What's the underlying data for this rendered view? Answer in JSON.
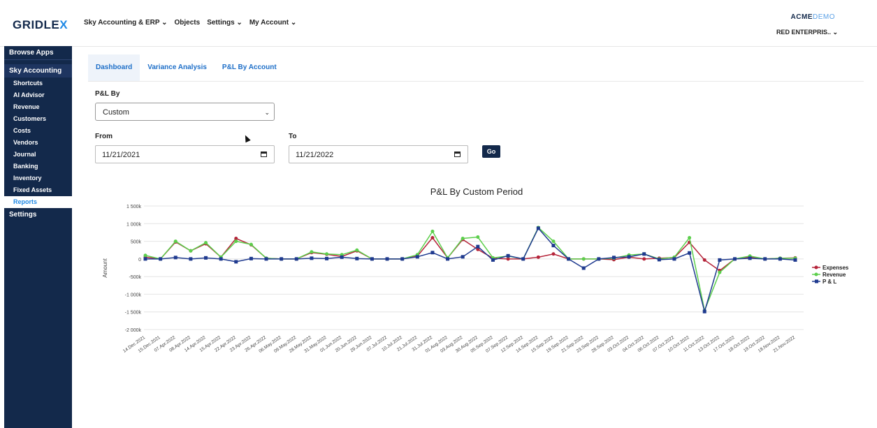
{
  "app": {
    "logo": "GRIDLE",
    "logo_x": "X",
    "brand_main": "ACME",
    "brand_accent": "DEMO",
    "company": "RED ENTERPRIS.. ⌄"
  },
  "topnav": [
    "Sky Accounting & ERP ⌄",
    "Objects",
    "Settings ⌄",
    "My Account ⌄"
  ],
  "sidebar": {
    "browse": "Browse Apps",
    "section": "Sky Accounting",
    "items": [
      "Shortcuts",
      "AI Advisor",
      "Revenue",
      "Customers",
      "Costs",
      "Vendors",
      "Journal",
      "Banking",
      "Inventory",
      "Fixed Assets",
      "Reports"
    ],
    "active_item": "Reports",
    "settings": "Settings"
  },
  "tabs": [
    "Dashboard",
    "Variance Analysis",
    "P&L By Account"
  ],
  "active_tab": "Dashboard",
  "form": {
    "pl_by_label": "P&L By",
    "pl_by_value": "Custom",
    "from_label": "From",
    "to_label": "To",
    "from_value": "11/21/2021",
    "to_value": "11/21/2022",
    "go_label": "Go"
  },
  "chart_data": {
    "type": "line",
    "title": "P&L By Custom Period",
    "ylabel": "Amount",
    "xlabel": "",
    "ylim": [
      -2000000,
      1500000
    ],
    "yticks": [
      1500000,
      1000000,
      500000,
      0,
      -500000,
      -1000000,
      -1500000,
      -2000000
    ],
    "ytick_labels": [
      "1 500k",
      "1 000k",
      "500k",
      "0",
      "-500k",
      "-1 000k",
      "-1 500k",
      "-2 000k"
    ],
    "categories": [
      "14.Dec.2021",
      "15.Dec.2021",
      "07.Apr.2022",
      "08.Apr.2022",
      "14.Apr.2022",
      "15.Apr.2022",
      "22.Apr.2022",
      "23.Apr.2022",
      "26.Apr.2022",
      "06.May.2022",
      "09.May.2022",
      "28.May.2022",
      "31.May.2022",
      "01.Jun.2022",
      "20.Jun.2022",
      "29.Jun.2022",
      "07.Jul.2022",
      "10.Jul.2022",
      "21.Jul.2022",
      "31.Jul.2022",
      "01.Aug.2022",
      "03.Aug.2022",
      "30.Aug.2022",
      "05.Sep.2022",
      "07.Sep.2022",
      "12.Sep.2022",
      "14.Sep.2022",
      "15.Sep.2022",
      "19.Sep.2022",
      "21.Sep.2022",
      "23.Sep.2022",
      "28.Sep.2022",
      "03.Oct.2022",
      "04.Oct.2022",
      "06.Oct.2022",
      "07.Oct.2022",
      "10.Oct.2022",
      "11.Oct.2022",
      "13.Oct.2022",
      "17.Oct.2022",
      "18.Oct.2022",
      "19.Oct.2022",
      "18.Nov.2022",
      "21.Nov.2022"
    ],
    "series": [
      {
        "name": "Expenses",
        "color": "#b5243a",
        "values": [
          50000,
          0,
          480000,
          230000,
          430000,
          50000,
          580000,
          400000,
          20000,
          0,
          0,
          180000,
          130000,
          70000,
          230000,
          0,
          0,
          0,
          80000,
          600000,
          30000,
          550000,
          270000,
          20000,
          0,
          0,
          50000,
          140000,
          0,
          0,
          0,
          -20000,
          50000,
          0,
          20000,
          40000,
          470000,
          -30000,
          -330000,
          0,
          50000,
          0,
          20000,
          30000
        ]
      },
      {
        "name": "Revenue",
        "color": "#5ccf4c",
        "values": [
          100000,
          0,
          500000,
          230000,
          460000,
          50000,
          500000,
          410000,
          20000,
          0,
          0,
          200000,
          140000,
          120000,
          250000,
          0,
          0,
          0,
          120000,
          780000,
          30000,
          580000,
          620000,
          30000,
          80000,
          0,
          890000,
          500000,
          0,
          0,
          0,
          20000,
          110000,
          140000,
          0,
          50000,
          600000,
          -1460000,
          -380000,
          0,
          80000,
          0,
          20000,
          20000
        ]
      },
      {
        "name": "P & L",
        "color": "#1f3a8f",
        "values": [
          0,
          0,
          40000,
          0,
          30000,
          0,
          -80000,
          10000,
          0,
          0,
          0,
          20000,
          10000,
          50000,
          10000,
          0,
          0,
          0,
          60000,
          180000,
          0,
          60000,
          350000,
          -30000,
          90000,
          0,
          870000,
          380000,
          0,
          -260000,
          0,
          40000,
          60000,
          140000,
          -20000,
          0,
          170000,
          -1490000,
          -30000,
          0,
          20000,
          0,
          0,
          -30000
        ]
      }
    ],
    "legend": "right",
    "grid": true
  }
}
